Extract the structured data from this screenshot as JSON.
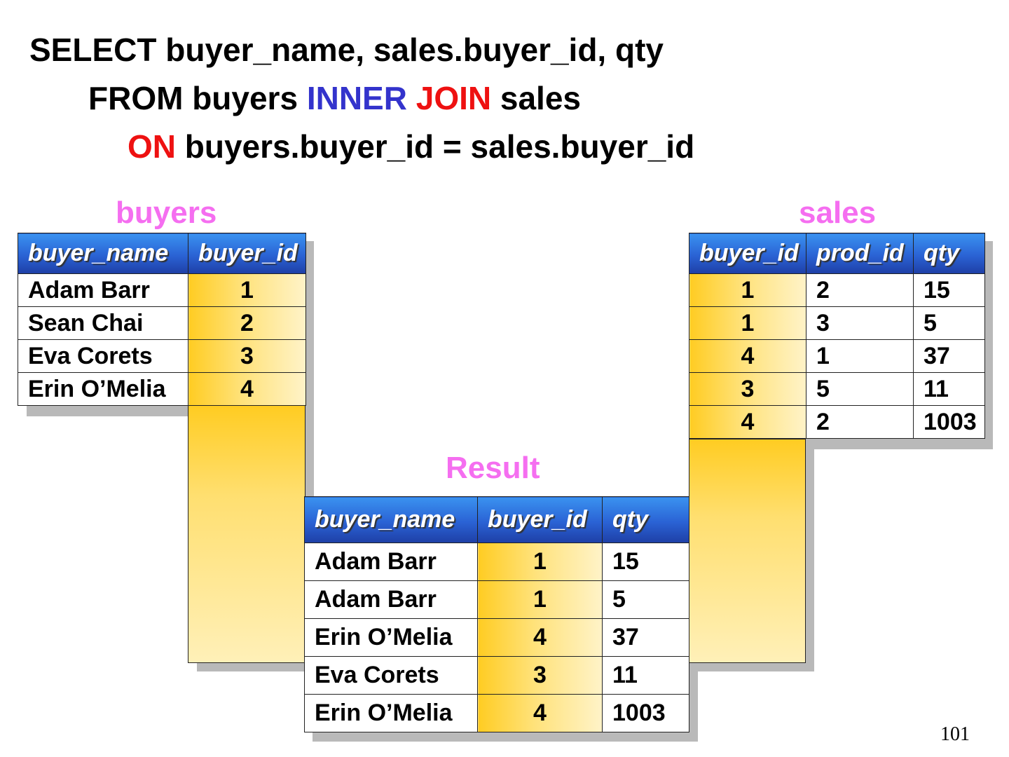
{
  "sql": {
    "line1": "SELECT buyer_name, sales.buyer_id, qty",
    "line2_prefix": "FROM buyers ",
    "line2_inner": "INNER",
    "line2_join": "JOIN",
    "line2_suffix": " sales",
    "line3_on": "ON",
    "line3_suffix": " buyers.buyer_id = sales.buyer_id"
  },
  "colors": {
    "keyword_blue": "#3333cc",
    "keyword_red": "#ee1111",
    "caption_pink": "#f56ef0",
    "header_blue": "#2a62d4",
    "key_gold": "#ffcc22"
  },
  "buyers": {
    "caption": "buyers",
    "headers": [
      "buyer_name",
      "buyer_id"
    ],
    "rows": [
      [
        "Adam Barr",
        "1"
      ],
      [
        "Sean Chai",
        "2"
      ],
      [
        "Eva Corets",
        "3"
      ],
      [
        "Erin O’Melia",
        "4"
      ]
    ]
  },
  "sales": {
    "caption": "sales",
    "headers": [
      "buyer_id",
      "prod_id",
      "qty"
    ],
    "rows": [
      [
        "1",
        "2",
        "15"
      ],
      [
        "1",
        "3",
        "5"
      ],
      [
        "4",
        "1",
        "37"
      ],
      [
        "3",
        "5",
        "11"
      ],
      [
        "4",
        "2",
        "1003"
      ]
    ]
  },
  "result": {
    "caption": "Result",
    "headers": [
      "buyer_name",
      "buyer_id",
      "qty"
    ],
    "rows": [
      [
        "Adam Barr",
        "1",
        "15"
      ],
      [
        "Adam Barr",
        "1",
        "5"
      ],
      [
        "Erin O’Melia",
        "4",
        "37"
      ],
      [
        "Eva Corets",
        "3",
        "11"
      ],
      [
        "Erin O’Melia",
        "4",
        "1003"
      ]
    ]
  },
  "page_number": "101"
}
